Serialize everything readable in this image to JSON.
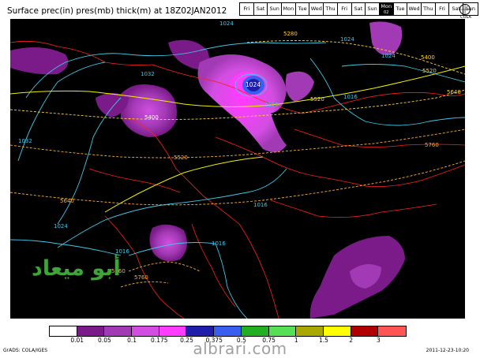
{
  "title": "Surface prec(in) pres(mb) thick(m) at 18Z02JAN2012",
  "day_strip": [
    {
      "label": "Fri",
      "active": false
    },
    {
      "label": "Sat",
      "active": false
    },
    {
      "label": "Sun",
      "active": false
    },
    {
      "label": "Mon",
      "active": false
    },
    {
      "label": "Tue",
      "active": false
    },
    {
      "label": "Wed",
      "active": false
    },
    {
      "label": "Thu",
      "active": false
    },
    {
      "label": "Fri",
      "active": false
    },
    {
      "label": "Sat",
      "active": false
    },
    {
      "label": "Sun",
      "active": false
    },
    {
      "label": "Mon",
      "active": true,
      "sub": "02"
    },
    {
      "label": "Tue",
      "active": false
    },
    {
      "label": "Wed",
      "active": false
    },
    {
      "label": "Thu",
      "active": false
    },
    {
      "label": "Fri",
      "active": false
    },
    {
      "label": "Sat",
      "active": false
    },
    {
      "label": "Sun",
      "active": false
    }
  ],
  "logo_text": "COLA",
  "map_labels": {
    "pressure": [
      "1024",
      "1024",
      "1032",
      "1032",
      "1024",
      "1016",
      "1016",
      "1016",
      "1016",
      "1024",
      "1016"
    ],
    "thickness": [
      "5280",
      "5400",
      "5520",
      "5640",
      "5400",
      "5520",
      "5640",
      "5760",
      "5760",
      "5760",
      "5520"
    ],
    "high_center": "1024"
  },
  "colorbar": {
    "colors": [
      "#ffffff",
      "#7a1b89",
      "#a33ab5",
      "#d24ee2",
      "#ff3cff",
      "#1e1eaa",
      "#3a5ff0",
      "#22b022",
      "#55e055",
      "#a8a800",
      "#ffff00",
      "#b00000",
      "#ff5555"
    ],
    "labels": [
      "0.01",
      "0.05",
      "0.1",
      "0.175",
      "0.25",
      "0.375",
      "0.5",
      "0.75",
      "1",
      "1.5",
      "2",
      "3"
    ]
  },
  "footer": {
    "credit": "GrADS: COLA/IGES",
    "timestamp": "2011-12-23-10:20"
  },
  "watermark": "albrari.com",
  "signature": "أبو ميعاد"
}
